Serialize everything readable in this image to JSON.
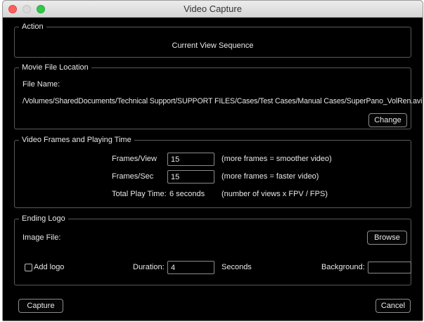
{
  "window": {
    "title": "Video Capture"
  },
  "action": {
    "legend": "Action",
    "value": "Current View Sequence"
  },
  "movie_file": {
    "legend": "Movie File Location",
    "file_name_label": "File Name:",
    "path": "/Volumes/SharedDocuments/Technical Support/SUPPORT FILES/Cases/Test Cases/Manual Cases/SuperPano_VolRen.avi",
    "change_label": "Change"
  },
  "frames": {
    "legend": "Video Frames and Playing Time",
    "frames_per_view_label": "Frames/View",
    "frames_per_view_value": "15",
    "frames_per_view_hint": "(more frames = smoother video)",
    "frames_per_sec_label": "Frames/Sec",
    "frames_per_sec_value": "15",
    "frames_per_sec_hint": "(more frames = faster video)",
    "total_label": "Total Play Time:",
    "total_value": "6 seconds",
    "total_hint": "(number of views x FPV / FPS)"
  },
  "ending_logo": {
    "legend": "Ending Logo",
    "image_file_label": "Image File:",
    "browse_label": "Browse",
    "add_logo_label": "Add logo",
    "add_logo_checked": false,
    "duration_label": "Duration:",
    "duration_value": "4",
    "seconds_label": "Seconds",
    "background_label": "Background:",
    "background_color": "#000000"
  },
  "footer": {
    "capture_label": "Capture",
    "cancel_label": "Cancel"
  }
}
